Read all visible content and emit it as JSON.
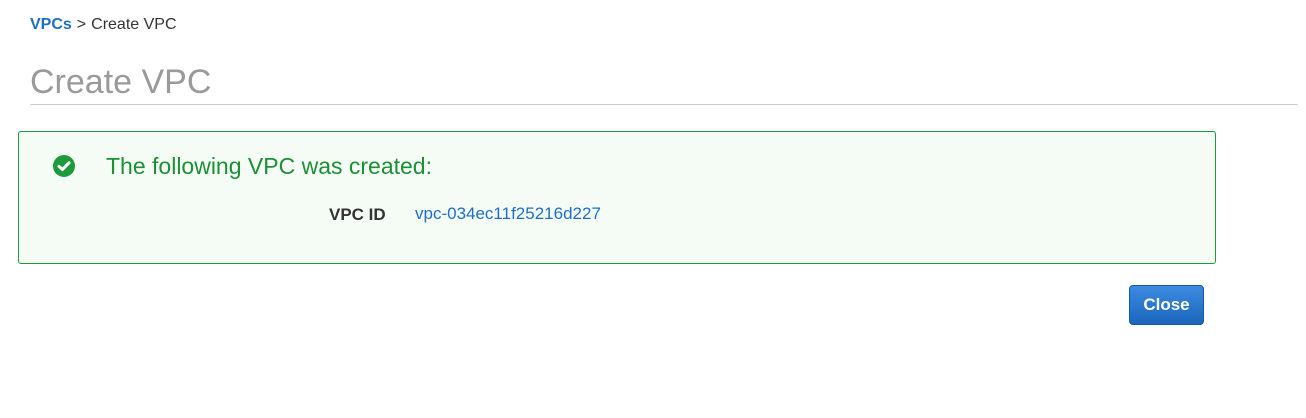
{
  "breadcrumb": {
    "parent_label": "VPCs",
    "separator": ">",
    "current_label": "Create VPC"
  },
  "header": {
    "title": "Create VPC"
  },
  "alert": {
    "type": "success",
    "icon": "check-circle-icon",
    "heading": "The following VPC was created:",
    "detail_label": "VPC ID",
    "detail_value": "vpc-034ec11f25216d227"
  },
  "actions": {
    "close_label": "Close"
  },
  "colors": {
    "link": "#1e6fc4",
    "success": "#1d8f35",
    "success_bg": "#f5fcf6",
    "primary_button": "#1a66be",
    "title_gray": "#9a9a9a"
  }
}
